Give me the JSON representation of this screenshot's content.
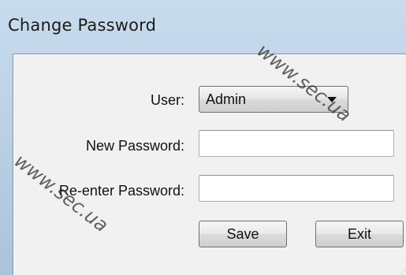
{
  "window": {
    "title": "Change Password"
  },
  "form": {
    "user_label": "User:",
    "user_selected": "Admin",
    "new_password_label": "New Password:",
    "new_password_value": "",
    "reenter_password_label": "Re-enter Password:",
    "reenter_password_value": "",
    "save_label": "Save",
    "exit_label": "Exit"
  },
  "watermark": {
    "text": "www.sec.ua"
  },
  "icons": {
    "dropdown": "chevron-down-icon",
    "resize": "resize-grip-icon"
  }
}
